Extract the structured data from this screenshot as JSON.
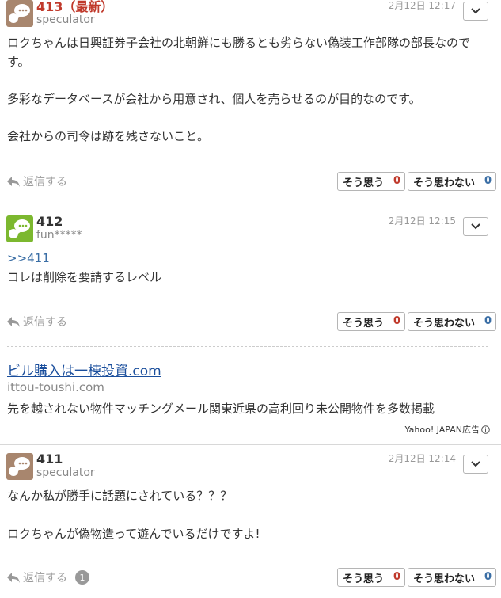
{
  "colors": {
    "accent_red": "#c0392b",
    "link_blue": "#3a6ea5",
    "avatar_brown": "#a8866e",
    "avatar_green": "#7cb82f"
  },
  "posts": [
    {
      "number": "413",
      "latest_tag": "（最新）",
      "username": "speculator",
      "date": "2月12日 12:17",
      "avatar_icon": "speech-bubble-avatar-brown",
      "paragraphs": [
        "ロクちゃんは日興証券子会社の北朝鮮にも勝るとも劣らない偽装工作部隊の部長なのです。",
        "多彩なデータベースが会社から用意され、個人を売らせるのが目的なのです。",
        "会社からの司令は跡を残さないこと。"
      ],
      "reply_label": "返信する",
      "agree_label": "そう思う",
      "agree_count": "0",
      "disagree_label": "そう思わない",
      "disagree_count": "0"
    },
    {
      "number": "412",
      "username": "fun*****",
      "date": "2月12日 12:15",
      "avatar_icon": "speech-bubble-avatar-green",
      "reply_ref": ">>411",
      "paragraphs": [
        "コレは削除を要請するレベル"
      ],
      "reply_label": "返信する",
      "agree_label": "そう思う",
      "agree_count": "0",
      "disagree_label": "そう思わない",
      "disagree_count": "0"
    },
    {
      "number": "411",
      "username": "speculator",
      "date": "2月12日 12:14",
      "avatar_icon": "speech-bubble-avatar-brown",
      "paragraphs": [
        "なんか私が勝手に話題にされている？？？",
        "ロクちゃんが偽物造って遊んでいるだけですよ!"
      ],
      "reply_label": "返信する",
      "reply_count": "1",
      "agree_label": "そう思う",
      "agree_count": "0",
      "disagree_label": "そう思わない",
      "disagree_count": "0"
    }
  ],
  "ad": {
    "title": "ビル購入は一棟投資.com",
    "domain": "ittou-toushi.com",
    "description": "先を越されない物件マッチングメール関東近県の高利回り未公開物件を多数掲載",
    "label": "Yahoo! JAPAN広告"
  }
}
